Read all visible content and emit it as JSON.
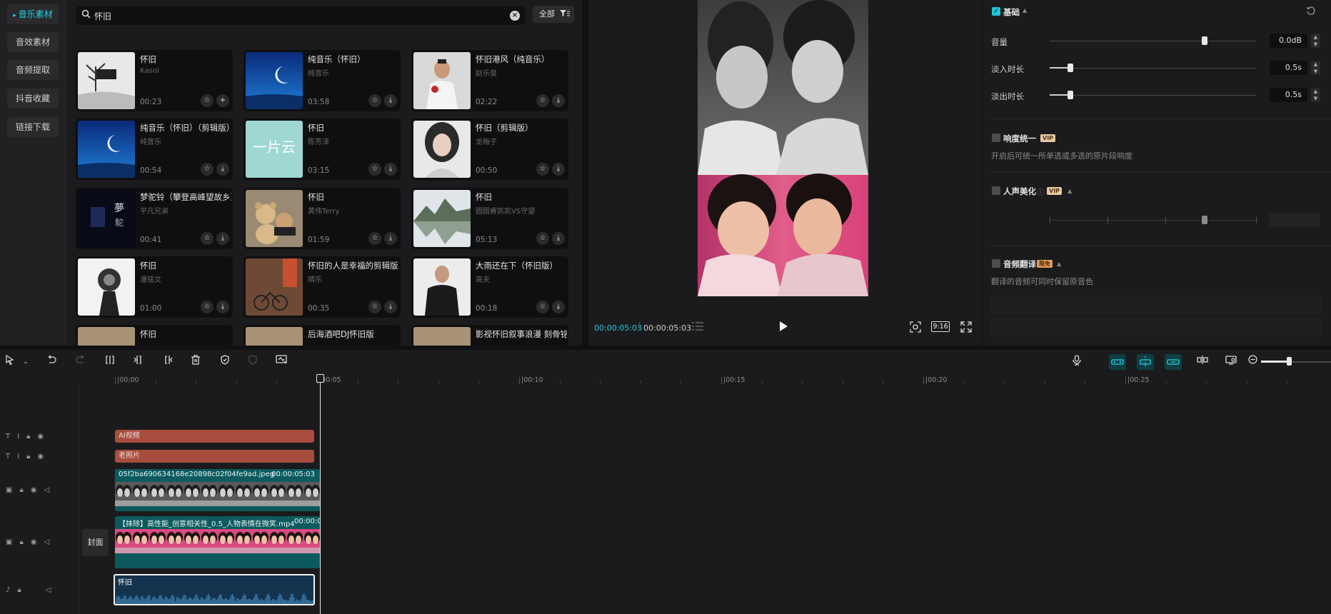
{
  "side_nav": {
    "items": [
      {
        "label": "音乐素材",
        "active": true
      },
      {
        "label": "音效素材",
        "active": false
      },
      {
        "label": "音频提取",
        "active": false
      },
      {
        "label": "抖音收藏",
        "active": false
      },
      {
        "label": "链接下载",
        "active": false
      }
    ]
  },
  "search": {
    "value": "怀旧",
    "filter_label": "全部"
  },
  "music_cards": [
    {
      "title": "怀旧",
      "artist": "Kasol",
      "duration": "00:23",
      "thumb": "snow-tree",
      "action": "add"
    },
    {
      "title": "纯音乐（怀旧）",
      "artist": "纯音乐",
      "duration": "03:58",
      "thumb": "blue-moon",
      "action": "download"
    },
    {
      "title": "怀旧港风（纯音乐）",
      "artist": "赵乐俊",
      "duration": "02:22",
      "thumb": "man-rose",
      "action": "download"
    },
    {
      "title": "纯音乐（怀旧）（剪辑版）",
      "artist": "纯音乐",
      "duration": "00:54",
      "thumb": "blue-moon",
      "action": "download"
    },
    {
      "title": "怀旧",
      "artist": "陈芳淳",
      "duration": "03:15",
      "thumb": "teal-text",
      "action": "download"
    },
    {
      "title": "怀旧（剪辑版）",
      "artist": "龙梅子",
      "duration": "00:50",
      "thumb": "woman-portrait",
      "action": "download"
    },
    {
      "title": "梦驼铃（攀登高峰望故乡）",
      "artist": "平凡兄弟",
      "duration": "00:41",
      "thumb": "dark-calligraphy",
      "action": "download"
    },
    {
      "title": "怀旧",
      "artist": "黄伟Terry",
      "duration": "01:59",
      "thumb": "teddy-bears",
      "action": "download"
    },
    {
      "title": "怀旧",
      "artist": "圆圆睿凯凯VS守望",
      "duration": "05:13",
      "thumb": "mountain-lake",
      "action": "download"
    },
    {
      "title": "怀旧",
      "artist": "潘铭文",
      "duration": "01:00",
      "thumb": "listen-photo",
      "action": "download"
    },
    {
      "title": "怀旧的人是幸福的剪辑版3",
      "artist": "晴乐",
      "duration": "00:35",
      "thumb": "street-bike",
      "action": "download"
    },
    {
      "title": "大雨还在下（怀旧版）",
      "artist": "高夫",
      "duration": "00:18",
      "thumb": "man-leather",
      "action": "download"
    },
    {
      "title": "怀旧",
      "artist": "",
      "duration": "",
      "thumb": "partial",
      "action": "none"
    },
    {
      "title": "后海酒吧DJ怀旧版",
      "artist": "",
      "duration": "",
      "thumb": "partial",
      "action": "none"
    },
    {
      "title": "影视怀旧叙事浪漫 刻骨铭",
      "artist": "",
      "duration": "",
      "thumb": "partial",
      "action": "none"
    }
  ],
  "preview": {
    "current_time": "00:00:05:03",
    "total_time": "00:00:05:03",
    "ratio": "9:16"
  },
  "properties": {
    "basic_title": "基础",
    "volume_label": "音量",
    "volume_value": "0.0dB",
    "volume_level": 0.75,
    "fade_in_label": "淡入时长",
    "fade_in_value": "0.5s",
    "fade_in_level": 0.1,
    "fade_out_label": "淡出时长",
    "fade_out_value": "0.5s",
    "fade_out_level": 0.1,
    "loudness_title": "响度统一",
    "loudness_desc": "开启后可统一所单选或多选的原片段响度",
    "voice_title": "人声美化",
    "voice_level": 0.75,
    "translate_title": "音频翻译",
    "translate_badge": "限免",
    "translate_desc": "翻译的音频可同时保留原音色",
    "vip_badge": "VIP"
  },
  "ruler": {
    "ticks": [
      "00:00",
      "00:05",
      "00:10",
      "00:15",
      "00:20",
      "00:25"
    ]
  },
  "timeline": {
    "text_clip_1": "AI视频",
    "text_clip_2": "老照片",
    "video_clip_1_name": "05f2ba690634168e20898c02f04fe9ad.jpeg",
    "video_clip_1_time": "00:00:05:03",
    "video_clip_2_name": "【抹除】高性能_创意相关性_0.5_人物表情在微笑.mp4",
    "video_clip_2_time": "00:00:0",
    "cover_label": "封面",
    "audio_clip_name": "怀旧"
  },
  "colors": {
    "accent": "#22d3e6",
    "text_clip": "#a84d3e",
    "video_clip": "#0d5a5e",
    "audio_clip": "#14334f"
  }
}
